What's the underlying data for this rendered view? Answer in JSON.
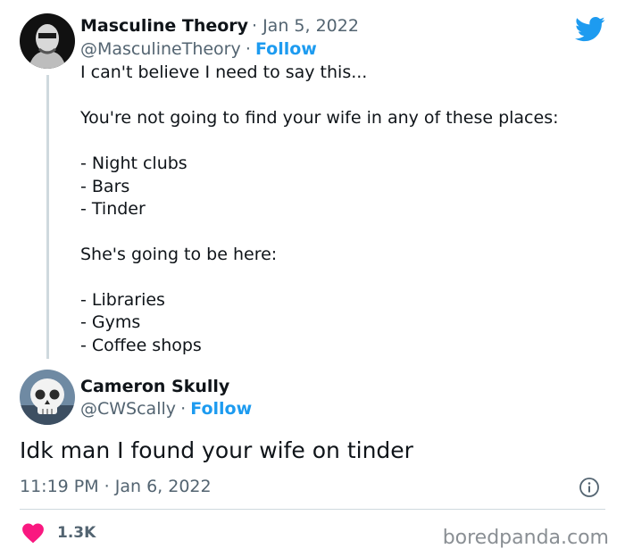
{
  "tweet": {
    "author_name": "Masculine Theory",
    "date": "· Jan 5, 2022",
    "handle": "@MasculineTheory",
    "dot": "·",
    "follow_label": "Follow",
    "lines": [
      "I can't believe I need to say this...",
      "",
      "You're not going to find your wife in any of these places:",
      "",
      "- Night clubs",
      "- Bars",
      "- Tinder",
      "",
      "She's going to be here:",
      "",
      "- Libraries",
      "- Gyms",
      "- Coffee shops"
    ]
  },
  "reply": {
    "author_name": "Cameron Skully",
    "handle": "@CWScally",
    "dot": "·",
    "follow_label": "Follow",
    "text": "Idk man I found your wife on tinder",
    "timestamp": "11:19 PM · Jan 6, 2022"
  },
  "engagement": {
    "like_count": "1.3K"
  },
  "watermark": "boredpanda.com",
  "icons": {
    "platform": "twitter-bird-icon",
    "info": "info-icon",
    "like": "heart-icon"
  },
  "colors": {
    "accent": "#1d9bf0",
    "like": "#f91880",
    "text": "#0f1419",
    "muted": "#536471"
  }
}
